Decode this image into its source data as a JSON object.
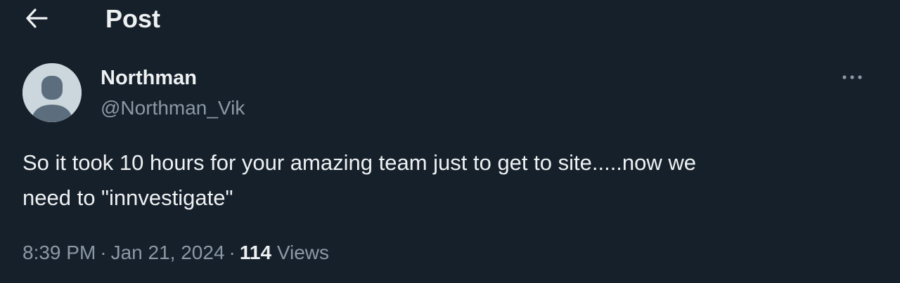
{
  "header": {
    "back_icon": "arrow-left-icon",
    "title": "Post"
  },
  "post": {
    "author": {
      "name": "Northman",
      "handle": "@Northman_Vik",
      "avatar_icon": "default-avatar-icon"
    },
    "more_icon": "more-horizontal-icon",
    "text_line1": "So it took 10 hours for your amazing team just to get to site.....now we",
    "text_line2": "need to \"innvestigate\"",
    "time": "8:39 PM",
    "separator": "·",
    "date": "Jan 21, 2024",
    "views_count": "114",
    "views_label": "Views"
  },
  "colors": {
    "background": "#16202b",
    "text_primary": "#eef1f2",
    "text_secondary": "#8b98a5",
    "avatar_bg": "#ccd6dd",
    "avatar_figure": "#5c6e7e"
  }
}
